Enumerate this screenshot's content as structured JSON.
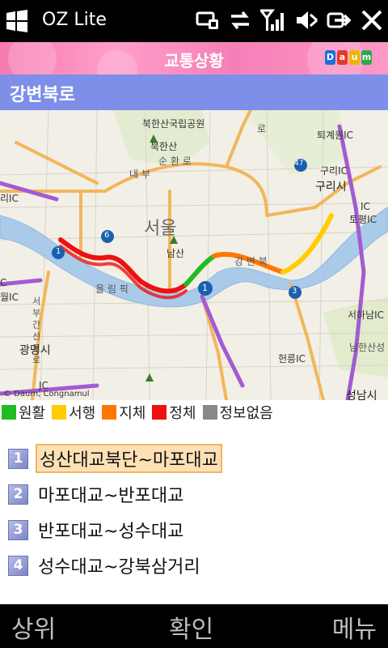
{
  "status_bar": {
    "app_title": "OZ Lite",
    "icons": [
      "windows-logo-icon",
      "connectivity-icon",
      "data-transfer-icon",
      "signal-icon",
      "volume-muted-icon",
      "ok-icon",
      "close-icon"
    ]
  },
  "header": {
    "title": "교통상황",
    "logo_letters": [
      "D",
      "a",
      "u",
      "m"
    ]
  },
  "road": {
    "name": "강변북로"
  },
  "map": {
    "labels": {
      "bukhansan_park": "북한산국립공원",
      "bukhansan": "북한산",
      "sunhwanro": "순 환 로",
      "seoul": "서울",
      "namsan": "남산",
      "toegyewon_ic": "퇴계원IC",
      "guri_ic": "구리IC",
      "guri_city": "구리시",
      "topyeong_ic": "토평IC",
      "ic": "IC",
      "hanam_ic": "서하남IC",
      "namhansan": "남한산성",
      "gwangmyeong": "광명시",
      "hyeonryung_ic": "헌릉IC",
      "seongnam": "성남시",
      "jc": "JC",
      "olympic": "올 림 픽",
      "naebu": "내 부",
      "gangbyeon": "강 변 북",
      "seobu": "서 부 간 선 도 로",
      "ro_mark": "로",
      "r47": "47",
      "r6": "6",
      "r1a": "1",
      "r1b": "1",
      "r3": "3",
      "ri_ic": "리IC",
      "wol_ic": "월IC",
      "c_ic": "C"
    },
    "copyright": "© Daum, Congnamul"
  },
  "legend": [
    {
      "label": "원활",
      "color": "#22bb22"
    },
    {
      "label": "서행",
      "color": "#ffcc00"
    },
    {
      "label": "지체",
      "color": "#ff7700"
    },
    {
      "label": "정체",
      "color": "#ee1111"
    },
    {
      "label": "정보없음",
      "color": "#888888"
    }
  ],
  "sections": [
    {
      "number": "1",
      "label": "성산대교북단~마포대교",
      "selected": true
    },
    {
      "number": "2",
      "label": "마포대교~반포대교",
      "selected": false
    },
    {
      "number": "3",
      "label": "반포대교~성수대교",
      "selected": false
    },
    {
      "number": "4",
      "label": "성수대교~강북삼거리",
      "selected": false
    }
  ],
  "softkeys": {
    "left": "상위",
    "center": "확인",
    "right": "메뉴"
  }
}
